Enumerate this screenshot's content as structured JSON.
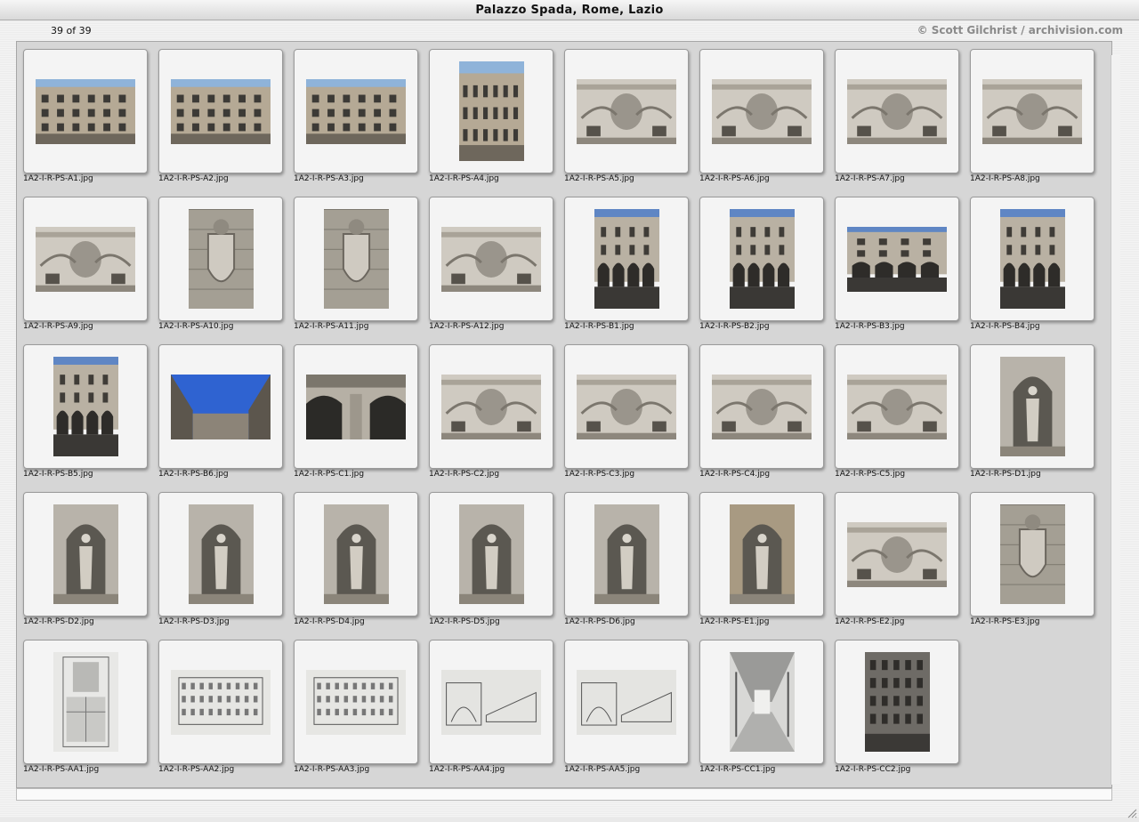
{
  "window": {
    "title": "Palazzo Spada, Rome, Lazio"
  },
  "header": {
    "counter": "39 of 39",
    "copyright": "© Scott Gilchrist / archivision.com"
  },
  "slides": [
    {
      "label": "1A2-I-R-PS-A1.jpg",
      "kind": "facade",
      "orient": "land"
    },
    {
      "label": "1A2-I-R-PS-A2.jpg",
      "kind": "facade",
      "orient": "land"
    },
    {
      "label": "1A2-I-R-PS-A3.jpg",
      "kind": "facade",
      "orient": "land"
    },
    {
      "label": "1A2-I-R-PS-A4.jpg",
      "kind": "facade",
      "orient": "port"
    },
    {
      "label": "1A2-I-R-PS-A5.jpg",
      "kind": "relief",
      "orient": "land"
    },
    {
      "label": "1A2-I-R-PS-A6.jpg",
      "kind": "relief",
      "orient": "land"
    },
    {
      "label": "1A2-I-R-PS-A7.jpg",
      "kind": "relief",
      "orient": "land"
    },
    {
      "label": "1A2-I-R-PS-A8.jpg",
      "kind": "relief",
      "orient": "land"
    },
    {
      "label": "1A2-I-R-PS-A9.jpg",
      "kind": "relief",
      "orient": "land"
    },
    {
      "label": "1A2-I-R-PS-A10.jpg",
      "kind": "crest",
      "orient": "port"
    },
    {
      "label": "1A2-I-R-PS-A11.jpg",
      "kind": "crest",
      "orient": "port"
    },
    {
      "label": "1A2-I-R-PS-A12.jpg",
      "kind": "relief",
      "orient": "land"
    },
    {
      "label": "1A2-I-R-PS-B1.jpg",
      "kind": "court",
      "orient": "port"
    },
    {
      "label": "1A2-I-R-PS-B2.jpg",
      "kind": "court",
      "orient": "port"
    },
    {
      "label": "1A2-I-R-PS-B3.jpg",
      "kind": "court",
      "orient": "land"
    },
    {
      "label": "1A2-I-R-PS-B4.jpg",
      "kind": "court",
      "orient": "port"
    },
    {
      "label": "1A2-I-R-PS-B5.jpg",
      "kind": "court",
      "orient": "port"
    },
    {
      "label": "1A2-I-R-PS-B6.jpg",
      "kind": "sky",
      "orient": "land"
    },
    {
      "label": "1A2-I-R-PS-C1.jpg",
      "kind": "arch",
      "orient": "land"
    },
    {
      "label": "1A2-I-R-PS-C2.jpg",
      "kind": "relief",
      "orient": "land"
    },
    {
      "label": "1A2-I-R-PS-C3.jpg",
      "kind": "relief",
      "orient": "land"
    },
    {
      "label": "1A2-I-R-PS-C4.jpg",
      "kind": "relief",
      "orient": "land"
    },
    {
      "label": "1A2-I-R-PS-C5.jpg",
      "kind": "relief",
      "orient": "land"
    },
    {
      "label": "1A2-I-R-PS-D1.jpg",
      "kind": "statue",
      "orient": "port"
    },
    {
      "label": "1A2-I-R-PS-D2.jpg",
      "kind": "statue",
      "orient": "port"
    },
    {
      "label": "1A2-I-R-PS-D3.jpg",
      "kind": "statue",
      "orient": "port"
    },
    {
      "label": "1A2-I-R-PS-D4.jpg",
      "kind": "statue",
      "orient": "port"
    },
    {
      "label": "1A2-I-R-PS-D5.jpg",
      "kind": "statue",
      "orient": "port"
    },
    {
      "label": "1A2-I-R-PS-D6.jpg",
      "kind": "statue",
      "orient": "port"
    },
    {
      "label": "1A2-I-R-PS-E1.jpg",
      "kind": "niche",
      "orient": "port"
    },
    {
      "label": "1A2-I-R-PS-E2.jpg",
      "kind": "relief",
      "orient": "land"
    },
    {
      "label": "1A2-I-R-PS-E3.jpg",
      "kind": "crest",
      "orient": "port"
    },
    {
      "label": "1A2-I-R-PS-AA1.jpg",
      "kind": "plan",
      "orient": "port"
    },
    {
      "label": "1A2-I-R-PS-AA2.jpg",
      "kind": "drawing",
      "orient": "land"
    },
    {
      "label": "1A2-I-R-PS-AA3.jpg",
      "kind": "drawing",
      "orient": "land"
    },
    {
      "label": "1A2-I-R-PS-AA4.jpg",
      "kind": "section",
      "orient": "land"
    },
    {
      "label": "1A2-I-R-PS-AA5.jpg",
      "kind": "section",
      "orient": "land"
    },
    {
      "label": "1A2-I-R-PS-CC1.jpg",
      "kind": "gallery",
      "orient": "port"
    },
    {
      "label": "1A2-I-R-PS-CC2.jpg",
      "kind": "oldphoto",
      "orient": "port"
    }
  ]
}
